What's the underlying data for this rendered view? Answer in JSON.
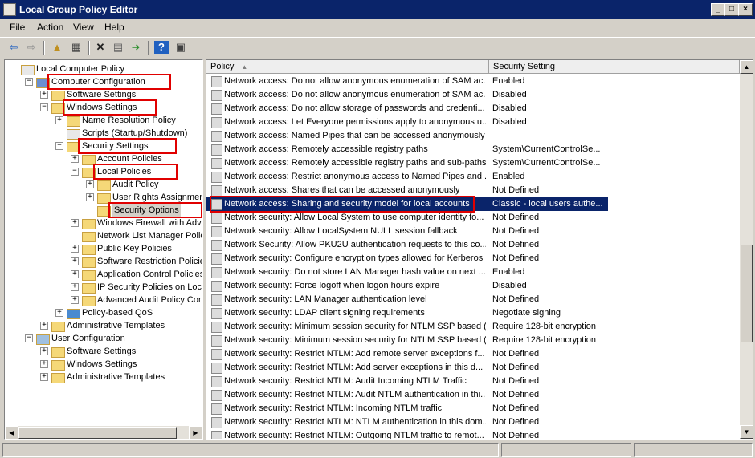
{
  "window": {
    "title": "Local Group Policy Editor"
  },
  "menu": [
    "File",
    "Action",
    "View",
    "Help"
  ],
  "toolbar_icons": [
    "back-icon",
    "forward-icon",
    "up-folder-icon",
    "show-hide-tree-icon",
    "delete-icon",
    "properties-icon",
    "export-list-icon",
    "help-icon",
    "show-pane-icon"
  ],
  "tree": [
    {
      "label": "Local Computer Policy",
      "indent": 0,
      "expander": "",
      "icon": "policy",
      "highlight": false
    },
    {
      "label": "Computer Configuration",
      "indent": 1,
      "expander": "minus",
      "icon": "computer",
      "highlight": true
    },
    {
      "label": "Software Settings",
      "indent": 2,
      "expander": "plus",
      "icon": "folder",
      "highlight": false
    },
    {
      "label": "Windows Settings",
      "indent": 2,
      "expander": "minus",
      "icon": "folder",
      "highlight": true
    },
    {
      "label": "Name Resolution Policy",
      "indent": 3,
      "expander": "plus",
      "icon": "folder",
      "highlight": false
    },
    {
      "label": "Scripts (Startup/Shutdown)",
      "indent": 3,
      "expander": "",
      "icon": "script",
      "highlight": false
    },
    {
      "label": "Security Settings",
      "indent": 3,
      "expander": "minus",
      "icon": "security",
      "highlight": true
    },
    {
      "label": "Account Policies",
      "indent": 4,
      "expander": "plus",
      "icon": "folder",
      "highlight": false
    },
    {
      "label": "Local Policies",
      "indent": 4,
      "expander": "minus",
      "icon": "folder",
      "highlight": true
    },
    {
      "label": "Audit Policy",
      "indent": 5,
      "expander": "plus",
      "icon": "folder",
      "highlight": false
    },
    {
      "label": "User Rights Assignment",
      "indent": 5,
      "expander": "plus",
      "icon": "folder",
      "highlight": false
    },
    {
      "label": "Security Options",
      "indent": 5,
      "expander": "",
      "icon": "folder",
      "highlight": true,
      "selected": true
    },
    {
      "label": "Windows Firewall with Advanc",
      "indent": 4,
      "expander": "plus",
      "icon": "folder",
      "highlight": false
    },
    {
      "label": "Network List Manager Policies",
      "indent": 4,
      "expander": "",
      "icon": "folder",
      "highlight": false
    },
    {
      "label": "Public Key Policies",
      "indent": 4,
      "expander": "plus",
      "icon": "folder",
      "highlight": false
    },
    {
      "label": "Software Restriction Policies",
      "indent": 4,
      "expander": "plus",
      "icon": "folder",
      "highlight": false
    },
    {
      "label": "Application Control Policies",
      "indent": 4,
      "expander": "plus",
      "icon": "folder",
      "highlight": false
    },
    {
      "label": "IP Security Policies on Local Co",
      "indent": 4,
      "expander": "plus",
      "icon": "folder",
      "highlight": false
    },
    {
      "label": "Advanced Audit Policy Configu",
      "indent": 4,
      "expander": "plus",
      "icon": "folder",
      "highlight": false
    },
    {
      "label": "Policy-based QoS",
      "indent": 3,
      "expander": "plus",
      "icon": "chart",
      "highlight": false
    },
    {
      "label": "Administrative Templates",
      "indent": 2,
      "expander": "plus",
      "icon": "folder",
      "highlight": false
    },
    {
      "label": "User Configuration",
      "indent": 1,
      "expander": "minus",
      "icon": "user",
      "highlight": false
    },
    {
      "label": "Software Settings",
      "indent": 2,
      "expander": "plus",
      "icon": "folder",
      "highlight": false
    },
    {
      "label": "Windows Settings",
      "indent": 2,
      "expander": "plus",
      "icon": "folder",
      "highlight": false
    },
    {
      "label": "Administrative Templates",
      "indent": 2,
      "expander": "plus",
      "icon": "folder",
      "highlight": false
    }
  ],
  "columns": {
    "policy": "Policy",
    "setting": "Security Setting"
  },
  "policies": [
    {
      "name": "Network access: Do not allow anonymous enumeration of SAM ac...",
      "setting": "Enabled"
    },
    {
      "name": "Network access: Do not allow anonymous enumeration of SAM ac...",
      "setting": "Disabled"
    },
    {
      "name": "Network access: Do not allow storage of passwords and credenti...",
      "setting": "Disabled"
    },
    {
      "name": "Network access: Let Everyone permissions apply to anonymous u...",
      "setting": "Disabled"
    },
    {
      "name": "Network access: Named Pipes that can be accessed anonymously",
      "setting": ""
    },
    {
      "name": "Network access: Remotely accessible registry paths",
      "setting": "System\\CurrentControlSe..."
    },
    {
      "name": "Network access: Remotely accessible registry paths and sub-paths",
      "setting": "System\\CurrentControlSe..."
    },
    {
      "name": "Network access: Restrict anonymous access to Named Pipes and ...",
      "setting": "Enabled"
    },
    {
      "name": "Network access: Shares that can be accessed anonymously",
      "setting": "Not Defined"
    },
    {
      "name": "Network access: Sharing and security model for local accounts",
      "setting": "Classic - local users authe...",
      "selected": true
    },
    {
      "name": "Network security: Allow Local System to use computer identity fo...",
      "setting": "Not Defined"
    },
    {
      "name": "Network security: Allow LocalSystem NULL session fallback",
      "setting": "Not Defined"
    },
    {
      "name": "Network Security: Allow PKU2U authentication requests to this co...",
      "setting": "Not Defined"
    },
    {
      "name": "Network security: Configure encryption types allowed for Kerberos",
      "setting": "Not Defined"
    },
    {
      "name": "Network security: Do not store LAN Manager hash value on next ...",
      "setting": "Enabled"
    },
    {
      "name": "Network security: Force logoff when logon hours expire",
      "setting": "Disabled"
    },
    {
      "name": "Network security: LAN Manager authentication level",
      "setting": "Not Defined"
    },
    {
      "name": "Network security: LDAP client signing requirements",
      "setting": "Negotiate signing"
    },
    {
      "name": "Network security: Minimum session security for NTLM SSP based (...",
      "setting": "Require 128-bit encryption"
    },
    {
      "name": "Network security: Minimum session security for NTLM SSP based (...",
      "setting": "Require 128-bit encryption"
    },
    {
      "name": "Network security: Restrict NTLM: Add remote server exceptions f...",
      "setting": "Not Defined"
    },
    {
      "name": "Network security: Restrict NTLM: Add server exceptions in this d...",
      "setting": "Not Defined"
    },
    {
      "name": "Network security: Restrict NTLM: Audit Incoming NTLM Traffic",
      "setting": "Not Defined"
    },
    {
      "name": "Network security: Restrict NTLM: Audit NTLM authentication in thi...",
      "setting": "Not Defined"
    },
    {
      "name": "Network security: Restrict NTLM: Incoming NTLM traffic",
      "setting": "Not Defined"
    },
    {
      "name": "Network security: Restrict NTLM: NTLM authentication in this dom...",
      "setting": "Not Defined"
    },
    {
      "name": "Network security: Restrict NTLM: Outgoing NTLM traffic to remot...",
      "setting": "Not Defined"
    }
  ],
  "colors": {
    "titlebar": "#0a246a",
    "selection": "#0a246a",
    "highlight": "#e00000",
    "folder": "#f5d878"
  }
}
